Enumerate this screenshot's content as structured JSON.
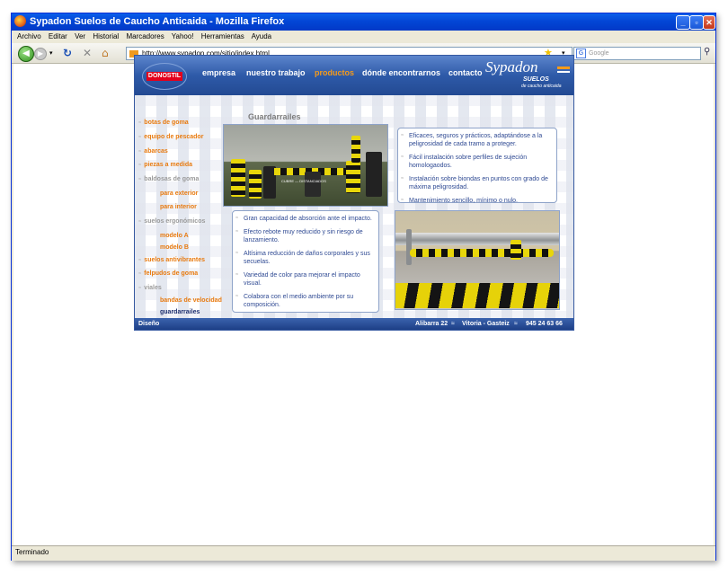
{
  "browser": {
    "title": "Sypadon Suelos de Caucho Anticaida - Mozilla Firefox",
    "menus": [
      "Archivo",
      "Editar",
      "Ver",
      "Historial",
      "Marcadores",
      "Yahoo!",
      "Herramientas",
      "Ayuda"
    ],
    "url": "http://www.sypadon.com/sitio/index.html",
    "search_placeholder": "Google",
    "status": "Terminado"
  },
  "site": {
    "logo_left": "DONOSTIL",
    "logo_right": {
      "brand": "Sypadon",
      "suelos": "SUELOS",
      "sub": "de caucho anticaida"
    },
    "nav": [
      "empresa",
      "nuestro trabajo",
      "productos",
      "dónde encontrarnos",
      "contacto"
    ],
    "nav_active_index": 2,
    "sidebar": [
      {
        "label": "botas de goma",
        "level": 0,
        "style": "orange"
      },
      {
        "label": "equipo de pescador",
        "level": 0,
        "style": "orange"
      },
      {
        "label": "abarcas",
        "level": 0,
        "style": "orange"
      },
      {
        "label": "piezas a medida",
        "level": 0,
        "style": "orange"
      },
      {
        "label": "baldosas de goma",
        "level": 0,
        "style": "grey"
      },
      {
        "label": "para exterior",
        "level": 1,
        "style": "orange"
      },
      {
        "label": "para interior",
        "level": 1,
        "style": "orange"
      },
      {
        "label": "suelos ergonómicos",
        "level": 0,
        "style": "grey"
      },
      {
        "label": "modelo A",
        "level": 1,
        "style": "orange"
      },
      {
        "label": "modelo B",
        "level": 1,
        "style": "orange"
      },
      {
        "label": "suelos antivibrantes",
        "level": 0,
        "style": "orange"
      },
      {
        "label": "felpudos de goma",
        "level": 0,
        "style": "orange"
      },
      {
        "label": "viales",
        "level": 0,
        "style": "grey"
      },
      {
        "label": "bandas de velocidad",
        "level": 1,
        "style": "orange"
      },
      {
        "label": "guardarrailes",
        "level": 1,
        "style": "active"
      }
    ],
    "heading": "Guardarrailes",
    "photo1_caption": "CUBRE  —  DISTANCIADOS",
    "box1": [
      "Eficaces, seguros y prácticos, adaptándose a la peligrosidad de cada tramo a proteger.",
      "Fácil instalación sobre perfiles de sujeción homologaodos.",
      "Instalación sobre biondas en puntos con grado de máxima peligrosidad.",
      "Mantenimiento sencillo, mínimo o nulo."
    ],
    "box2": [
      "Gran capacidad de absorción ante el impacto.",
      "Efecto rebote muy reducido y sin riesgo de lanzamiento.",
      "Altísima reducción de daños corporales y sus secuelas.",
      "Variedad de color para mejorar el impacto visual.",
      "Colabora con el medio ambiente por su composición."
    ],
    "footer": {
      "left": "Diseño",
      "address": "Alibarra 22",
      "city": "Vitoria - Gasteiz",
      "phone": "945 24 63 66"
    },
    "colors": {
      "accent": "#e87a0f",
      "header_blue": "#2e5aa8",
      "text_blue": "#2f4a93"
    }
  }
}
